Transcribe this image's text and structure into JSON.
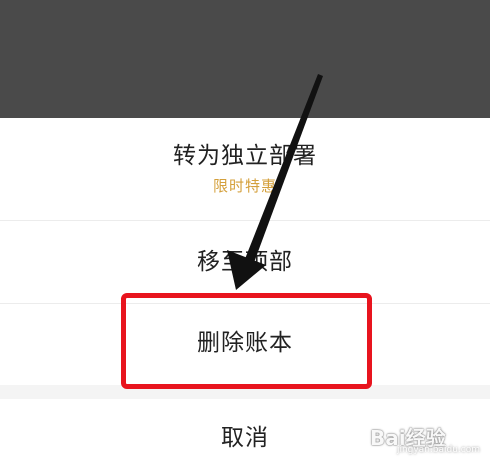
{
  "menu": {
    "standalone_label": "转为独立部署",
    "standalone_sub": "限时特惠",
    "move_label": "移至顶部",
    "delete_label": "删除账本",
    "cancel_label": "取消"
  },
  "colors": {
    "overlay": "#4a4a4a",
    "promo": "#d4a03c",
    "highlight": "#e8141e",
    "arrow": "#111111"
  },
  "watermark": {
    "logo_text": "Bai经验",
    "sub_text": "jingyan.baidu.com",
    "icon": "paw-icon"
  }
}
